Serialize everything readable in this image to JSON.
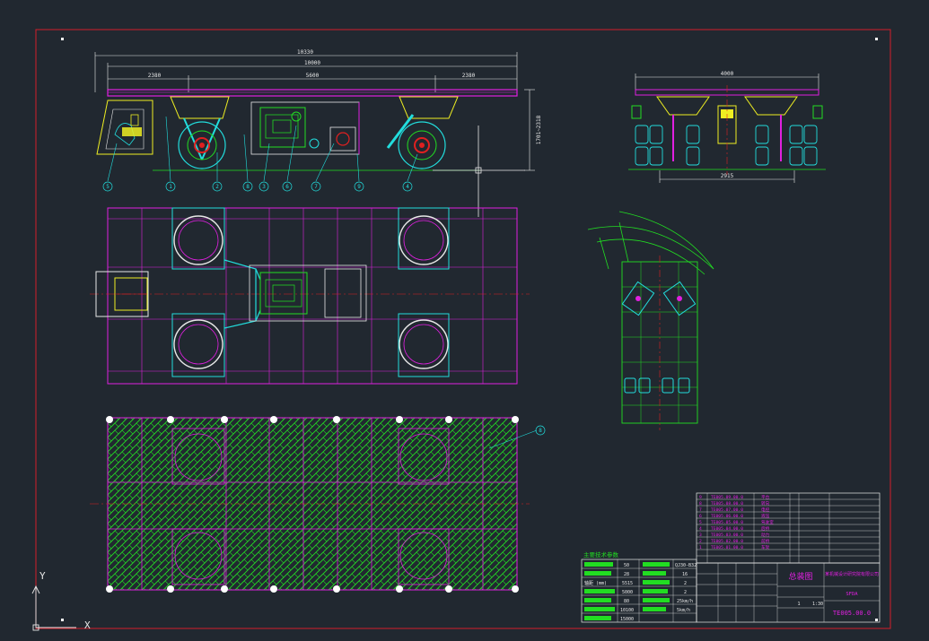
{
  "colors": {
    "background": "#212830",
    "frame": "#d21e2a",
    "magenta": "#e020e0",
    "green": "#22dd22",
    "cyan": "#22dddd",
    "yellow": "#eeee22",
    "white": "#e8e8e8",
    "red": "#e02020"
  },
  "dimensions": {
    "overall_length": "10330",
    "main_length": "10000",
    "left_span": "2380",
    "middle_span": "5600",
    "right_span": "2380",
    "height": "1701~2318",
    "end_width": "4000",
    "end_inner": "2915"
  },
  "balloons": [
    "5",
    "1",
    "2",
    "8",
    "3",
    "6",
    "7",
    "9",
    "4",
    "8"
  ],
  "right_balloon": "8",
  "tech_table": {
    "title": "主要技术参数",
    "rows": [
      {
        "label": "",
        "v1": "50",
        "v2": "",
        "v3": "QJ30-B32"
      },
      {
        "label": "",
        "v1": "28",
        "v2": "",
        "v3": "16"
      },
      {
        "label": "轴距 (mm)",
        "v1": "5515",
        "v2": "",
        "v3": "2"
      },
      {
        "label": "",
        "v1": "5000",
        "v2": "",
        "v3": "2"
      },
      {
        "label": "",
        "v1": "80",
        "v2": "",
        "v3": "25km/h"
      },
      {
        "label": "",
        "v1": "10100",
        "v2": "",
        "v3": "5km/h"
      },
      {
        "label": "",
        "v1": "15000",
        "v2": "",
        "v3": ""
      }
    ]
  },
  "title_block": {
    "drawing_title": "总装图",
    "company": "某机械设计研究院有限公司",
    "scale": "1:30",
    "sheet": "1",
    "stage": "SFDA",
    "drawing_number": "TE005.00.0"
  },
  "parts_list": [
    {
      "no": "9",
      "code": "TE005.09.00.0",
      "name": "平台"
    },
    {
      "no": "8",
      "code": "TE005.08.00.0",
      "name": "转向"
    },
    {
      "no": "7",
      "code": "TE005.07.00.0",
      "name": "电控"
    },
    {
      "no": "6",
      "code": "TE005.06.00.0",
      "name": "液压"
    },
    {
      "no": "5",
      "code": "TE005.05.00.0",
      "name": "驾驶室"
    },
    {
      "no": "4",
      "code": "TE005.04.00.0",
      "name": "后桥"
    },
    {
      "no": "3",
      "code": "TE005.03.00.0",
      "name": "动力"
    },
    {
      "no": "2",
      "code": "TE005.02.00.0",
      "name": "前桥"
    },
    {
      "no": "1",
      "code": "TE005.01.00.0",
      "name": "车架"
    }
  ],
  "ucs": {
    "y": "Y",
    "x": "X"
  }
}
